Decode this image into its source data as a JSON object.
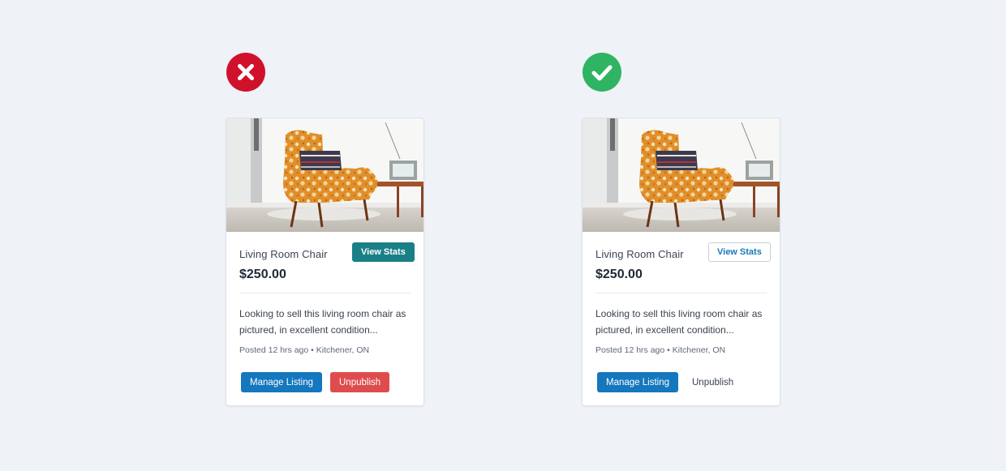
{
  "colors": {
    "bad": "#d0112b",
    "good": "#2fb463",
    "teal": "#1b7f86",
    "primary": "#1577bd",
    "danger": "#df4c4e",
    "background": "#eff2f7"
  },
  "panels": [
    {
      "verdict": "incorrect",
      "verdict_icon": "x-icon",
      "listing": {
        "title": "Living Room Chair",
        "price": "$250.00",
        "stats_button": "View Stats",
        "description": "Looking to sell this living room chair as pictured, in excellent condition...",
        "meta": "Posted 12 hrs ago • Kitchener, ON",
        "manage_button": "Manage Listing",
        "unpublish_button": "Unpublish"
      }
    },
    {
      "verdict": "correct",
      "verdict_icon": "checkmark-icon",
      "listing": {
        "title": "Living Room Chair",
        "price": "$250.00",
        "stats_button": "View Stats",
        "description": "Looking to sell this living room chair as pictured, in excellent condition...",
        "meta": "Posted 12 hrs ago • Kitchener, ON",
        "manage_button": "Manage Listing",
        "unpublish_button": "Unpublish"
      }
    }
  ]
}
